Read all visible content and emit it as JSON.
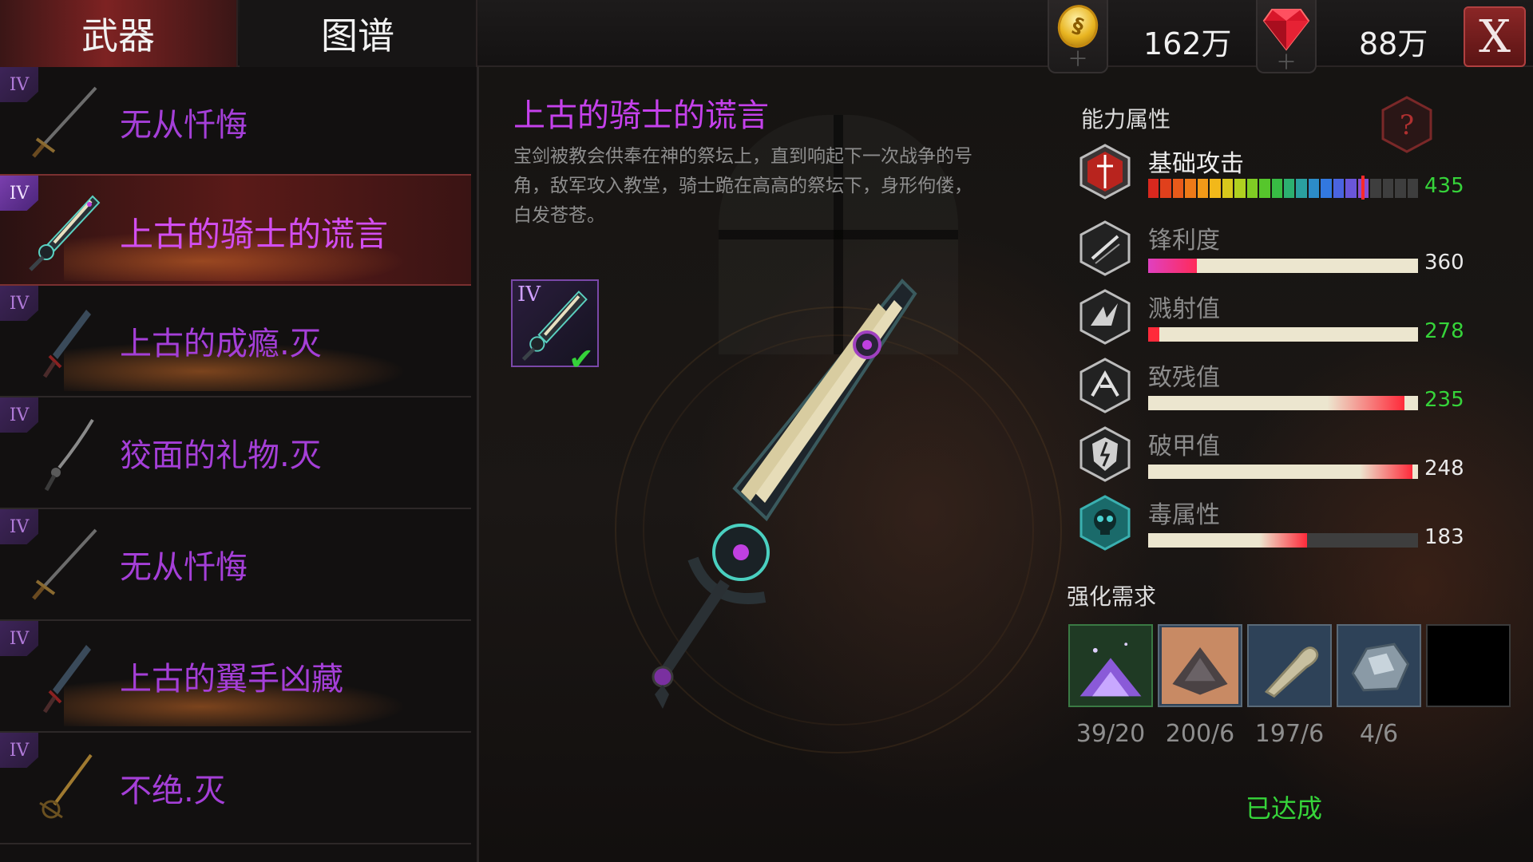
{
  "tabs": {
    "weapons": "武器",
    "codex": "图谱"
  },
  "currency": {
    "coins": "162万",
    "gems": "88万",
    "close": "X"
  },
  "weapon_list": [
    {
      "rank": "IV",
      "name": "无从忏悔",
      "selected": false
    },
    {
      "rank": "IV",
      "name": "上古的骑士的谎言",
      "selected": true
    },
    {
      "rank": "IV",
      "name": "上古的成瘾.灭",
      "selected": false
    },
    {
      "rank": "IV",
      "name": "狡面的礼物.灭",
      "selected": false
    },
    {
      "rank": "IV",
      "name": "无从忏悔",
      "selected": false
    },
    {
      "rank": "IV",
      "name": "上古的翼手凶藏",
      "selected": false
    },
    {
      "rank": "IV",
      "name": "不绝.灭",
      "selected": false
    }
  ],
  "detail": {
    "title": "上古的骑士的谎言",
    "description": "宝剑被教会供奉在神的祭坛上，直到响起下一次战争的号角，敌军攻入教堂，骑士跪在高高的祭坛下，身形佝偻，白发苍苍。",
    "rank": "IV"
  },
  "stats": {
    "title": "能力属性",
    "help": "?",
    "items": [
      {
        "label": "基础攻击",
        "value": "435",
        "fraction": 0.79,
        "icon": "sword-shield-icon"
      },
      {
        "label": "锋利度",
        "value": "360",
        "fraction": 0.18,
        "icon": "blade-icon"
      },
      {
        "label": "溅射值",
        "value": "278",
        "fraction": 0.04,
        "icon": "splash-icon"
      },
      {
        "label": "致残值",
        "value": "235",
        "fraction": 0.95,
        "icon": "cripple-icon"
      },
      {
        "label": "破甲值",
        "value": "248",
        "fraction": 0.98,
        "icon": "armor-break-icon"
      },
      {
        "label": "毒属性",
        "value": "183",
        "fraction": 0.59,
        "icon": "poison-skull-icon"
      }
    ]
  },
  "requirements": {
    "title": "强化需求",
    "items": [
      {
        "count": "39/20",
        "icon": "purple-dust-icon"
      },
      {
        "count": "200/6",
        "icon": "ore-pile-icon"
      },
      {
        "count": "197/6",
        "icon": "bone-icon"
      },
      {
        "count": "4/6",
        "icon": "crystal-rock-icon"
      }
    ],
    "status": "已达成"
  },
  "colors": {
    "accent_purple": "#c541ec",
    "green": "#36d43a",
    "tab_active": "#7d2222"
  }
}
